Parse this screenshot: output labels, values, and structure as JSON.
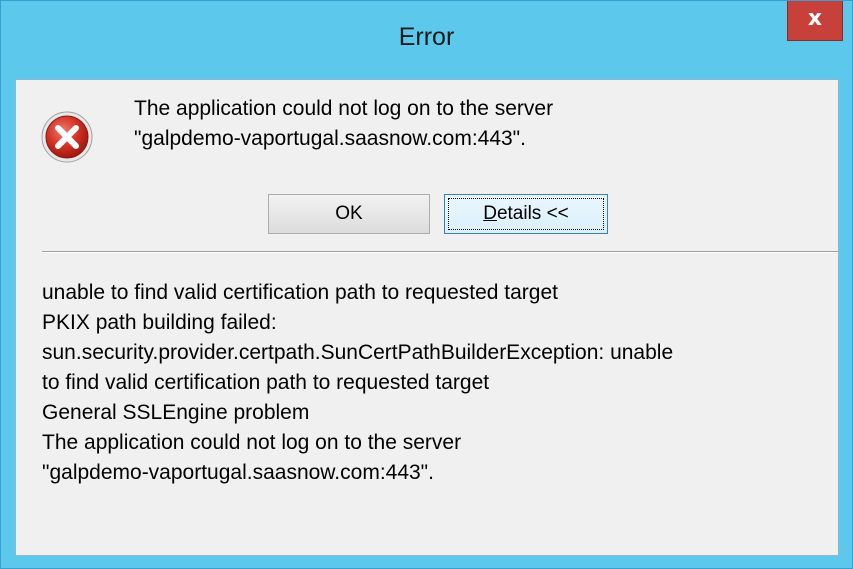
{
  "window": {
    "title": "Error",
    "close_label": "x"
  },
  "icon": "error-icon",
  "message": {
    "line1": "The application could not log on to the server",
    "line2": "\"galpdemo-vaportugal.saasnow.com:443\"."
  },
  "buttons": {
    "ok": "OK",
    "details_underlined": "D",
    "details_rest": "etails <<"
  },
  "details": {
    "lines": [
      "unable to find valid certification path to requested target",
      "PKIX path building failed:",
      "sun.security.provider.certpath.SunCertPathBuilderException: unable",
      "to find valid certification path to requested target",
      "General SSLEngine problem",
      "The application could not log on to the server",
      "\"galpdemo-vaportugal.saasnow.com:443\"."
    ]
  },
  "colors": {
    "titlebar": "#5cc8ec",
    "close_button": "#c7413a",
    "client_background": "#f0f0f0"
  }
}
